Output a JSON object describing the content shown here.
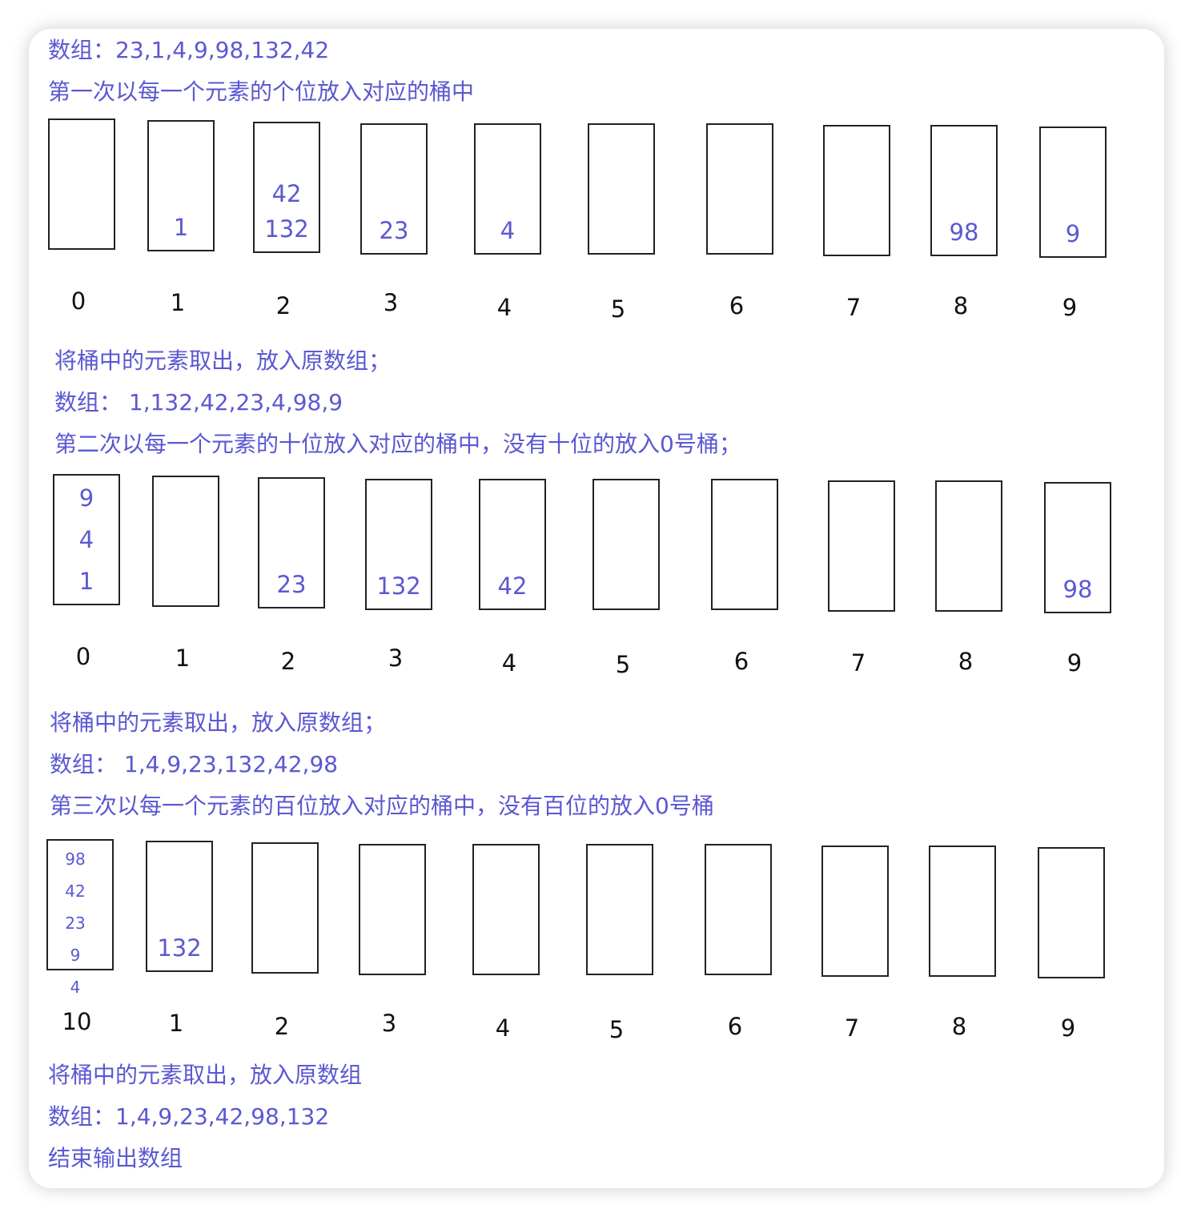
{
  "lines": {
    "array0": "数组：23,1,4,9,98,132,42",
    "step1": "第一次以每一个元素的个位放入对应的桶中",
    "take1": "将桶中的元素取出，放入原数组；",
    "array1": "数组：  1,132,42,23,4,98,9",
    "step2": "第二次以每一个元素的十位放入对应的桶中，没有十位的放入0号桶；",
    "take2": "将桶中的元素取出，放入原数组；",
    "array2": "数组：  1,4,9,23,132,42,98",
    "step3": "第三次以每一个元素的百位放入对应的桶中，没有百位的放入0号桶",
    "take3": "将桶中的元素取出，放入原数组",
    "array3": "数组：1,4,9,23,42,98,132",
    "end": "结束输出数组"
  },
  "rounds": [
    {
      "labels": [
        "0",
        "1",
        "2",
        "3",
        "4",
        "5",
        "6",
        "7",
        "8",
        "9"
      ],
      "buckets": [
        [],
        [
          "1"
        ],
        [
          "42",
          "132"
        ],
        [
          "23"
        ],
        [
          "4"
        ],
        [],
        [],
        [],
        [
          "98"
        ],
        [
          "9"
        ]
      ]
    },
    {
      "labels": [
        "0",
        "1",
        "2",
        "3",
        "4",
        "5",
        "6",
        "7",
        "8",
        "9"
      ],
      "buckets": [
        [
          "9",
          "4",
          "1"
        ],
        [],
        [
          "23"
        ],
        [
          "132"
        ],
        [
          "42"
        ],
        [],
        [],
        [],
        [],
        [
          "98"
        ]
      ]
    },
    {
      "labels": [
        "10",
        "1",
        "2",
        "3",
        "4",
        "5",
        "6",
        "7",
        "8",
        "9"
      ],
      "buckets": [
        [
          "98",
          "42",
          "23",
          "9",
          "4"
        ],
        [
          "132"
        ],
        [],
        [],
        [],
        [],
        [],
        [],
        [],
        []
      ]
    }
  ],
  "colors": {
    "text": "#5b58d2",
    "labels": "#111111",
    "border": "#222222"
  }
}
